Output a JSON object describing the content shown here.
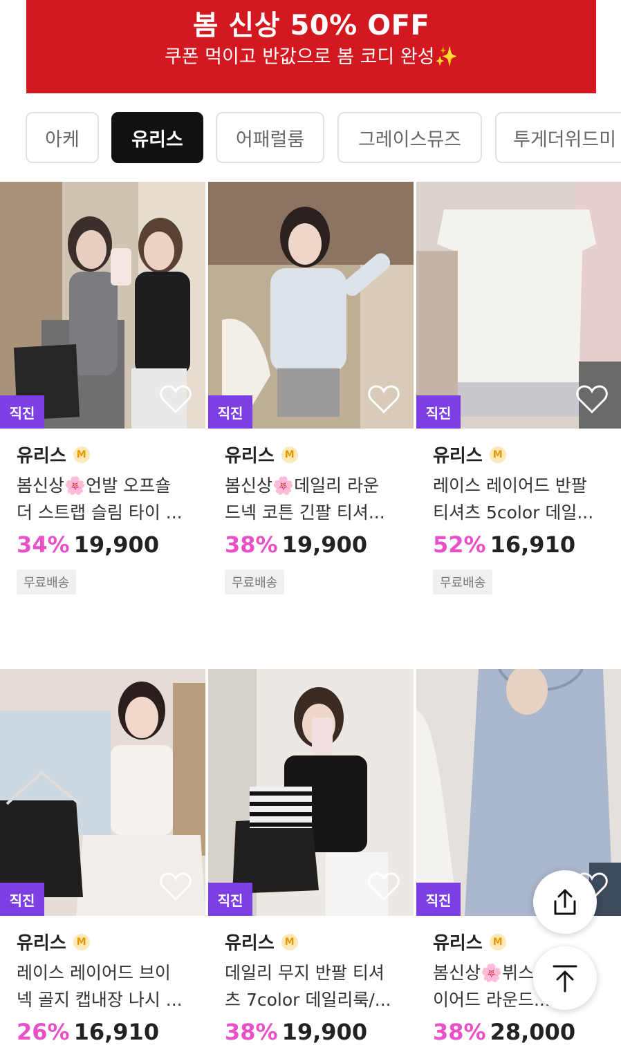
{
  "banner": {
    "title": "봄 신상 50% OFF",
    "subtitle": "쿠폰 먹이고 반값으로 봄 코디 완성✨"
  },
  "tabs": [
    {
      "label": "아케",
      "active": false
    },
    {
      "label": "유리스",
      "active": true
    },
    {
      "label": "어패럴룸",
      "active": false
    },
    {
      "label": "그레이스뮤즈",
      "active": false
    },
    {
      "label": "투게더위드미",
      "active": false
    }
  ],
  "products": [
    {
      "badge": "직진",
      "shop": "유리스",
      "shop_badge": "M",
      "desc_line1": "봄신상🌸언발 오프숄",
      "desc_line2": "더 스트랩 슬림 타이 ...",
      "discount": "34%",
      "price": "19,900",
      "shipping": "무료배송"
    },
    {
      "badge": "직진",
      "shop": "유리스",
      "shop_badge": "M",
      "desc_line1": "봄신상🌸데일리 라운",
      "desc_line2": "드넥 코튼 긴팔 티셔...",
      "discount": "38%",
      "price": "19,900",
      "shipping": "무료배송"
    },
    {
      "badge": "직진",
      "shop": "유리스",
      "shop_badge": "M",
      "desc_line1": "레이스 레이어드 반팔",
      "desc_line2": "티셔츠 5color 데일...",
      "discount": "52%",
      "price": "16,910",
      "shipping": "무료배송"
    },
    {
      "badge": "직진",
      "shop": "유리스",
      "shop_badge": "M",
      "desc_line1": "레이스 레이어드 브이",
      "desc_line2": "넥 골지 캡내장 나시 ...",
      "discount": "26%",
      "price": "16,910"
    },
    {
      "badge": "직진",
      "shop": "유리스",
      "shop_badge": "M",
      "desc_line1": "데일리 무지 반팔 티셔",
      "desc_line2": "츠 7color 데일리룩/...",
      "discount": "38%",
      "price": "19,900"
    },
    {
      "badge": "직진",
      "shop": "유리스",
      "shop_badge": "M",
      "desc_line1": "봄신상🌸뷔스",
      "desc_line2": "이어드 라운드...",
      "discount": "38%",
      "price": "28,000"
    }
  ],
  "colors": {
    "banner": "#d3191f",
    "badge": "#7b3fe4",
    "discount": "#e94fc6"
  },
  "icons": {
    "share": "share-icon",
    "scroll_top": "arrow-up-icon",
    "wishlist": "heart-icon"
  }
}
